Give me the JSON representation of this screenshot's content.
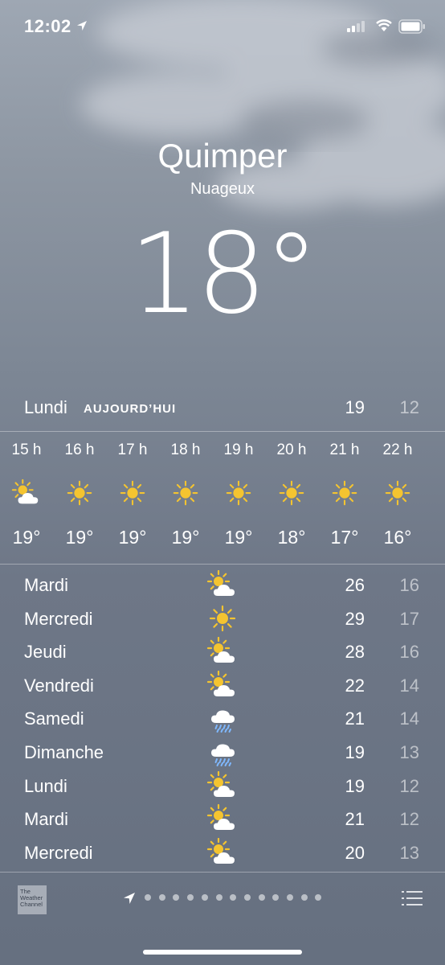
{
  "status_bar": {
    "time": "12:02"
  },
  "weather": {
    "city": "Quimper",
    "condition": "Nuageux",
    "temperature": "18°"
  },
  "today": {
    "day": "Lundi",
    "tag": "AUJOURD’HUI",
    "high": "19",
    "low": "12"
  },
  "hourly": [
    {
      "label": "15 h",
      "icon": "sun-cloud",
      "temp": "19°"
    },
    {
      "label": "16 h",
      "icon": "sun",
      "temp": "19°"
    },
    {
      "label": "17 h",
      "icon": "sun",
      "temp": "19°"
    },
    {
      "label": "18 h",
      "icon": "sun",
      "temp": "19°"
    },
    {
      "label": "19 h",
      "icon": "sun",
      "temp": "19°"
    },
    {
      "label": "20 h",
      "icon": "sun",
      "temp": "18°"
    },
    {
      "label": "21 h",
      "icon": "sun",
      "temp": "17°"
    },
    {
      "label": "22 h",
      "icon": "sun",
      "temp": "16°"
    }
  ],
  "daily": [
    {
      "day": "Mardi",
      "icon": "sun-cloud",
      "high": "26",
      "low": "16"
    },
    {
      "day": "Mercredi",
      "icon": "sun",
      "high": "29",
      "low": "17"
    },
    {
      "day": "Jeudi",
      "icon": "sun-cloud",
      "high": "28",
      "low": "16"
    },
    {
      "day": "Vendredi",
      "icon": "sun-cloud",
      "high": "22",
      "low": "14"
    },
    {
      "day": "Samedi",
      "icon": "rain-cloud",
      "high": "21",
      "low": "14"
    },
    {
      "day": "Dimanche",
      "icon": "rain-cloud",
      "high": "19",
      "low": "13"
    },
    {
      "day": "Lundi",
      "icon": "sun-cloud",
      "high": "19",
      "low": "12"
    },
    {
      "day": "Mardi",
      "icon": "sun-cloud",
      "high": "21",
      "low": "12"
    },
    {
      "day": "Mercredi",
      "icon": "sun-cloud",
      "high": "20",
      "low": "13"
    }
  ],
  "footer": {
    "provider_logo": "The Weather Channel",
    "page_count": 13
  },
  "colors": {
    "sun": "#f4c430",
    "cloud": "#ffffff",
    "rain": "#7fb8ff"
  }
}
